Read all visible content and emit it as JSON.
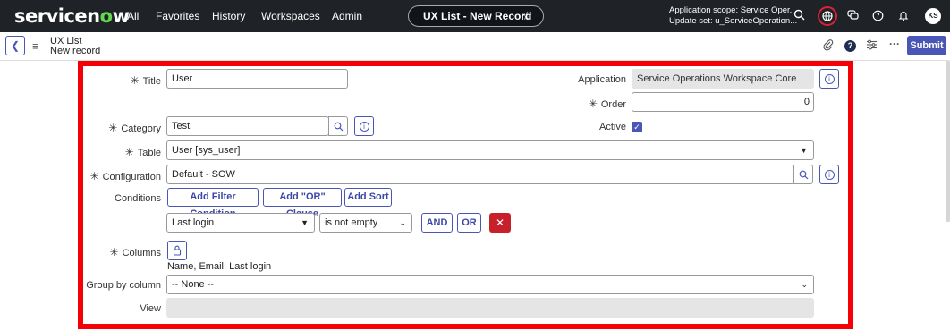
{
  "topnav": {
    "brand_prefix": "servicen",
    "brand_o": "o",
    "brand_suffix": "w",
    "items": [
      "All",
      "Favorites",
      "History",
      "Workspaces",
      "Admin"
    ],
    "pill_title": "UX List - New Record",
    "star_glyph": "☆",
    "scope_line1": "Application scope: Service Oper...",
    "scope_line2": "Update set: u_ServiceOperation...",
    "avatar_initials": "KS",
    "icons": [
      "search-icon",
      "globe-icon",
      "chat-icon",
      "help-icon",
      "bell-icon"
    ]
  },
  "subheader": {
    "record_type": "UX List",
    "record_state": "New record",
    "submit_label": "Submit",
    "icons": [
      "back-icon",
      "menu-icon",
      "attachment-icon",
      "help-icon",
      "settings-icon",
      "more-icon"
    ]
  },
  "form": {
    "title_label": "Title",
    "title_value": "User",
    "application_label": "Application",
    "application_value": "Service Operations Workspace Core",
    "order_label": "Order",
    "order_value": "0",
    "category_label": "Category",
    "category_value": "Test",
    "active_label": "Active",
    "active_checked": true,
    "table_label": "Table",
    "table_value": "User [sys_user]",
    "configuration_label": "Configuration",
    "configuration_value": "Default - SOW",
    "conditions_label": "Conditions",
    "add_filter_label": "Add Filter Condition",
    "add_or_label": "Add \"OR\" Clause",
    "add_sort_label": "Add Sort",
    "cond_field": "Last login",
    "cond_operator": "is not empty",
    "and_label": "AND",
    "or_label": "OR",
    "columns_label": "Columns",
    "columns_value": "Name, Email, Last login",
    "group_by_label": "Group by column",
    "group_by_value": "-- None --",
    "view_label": "View",
    "view_value": ""
  },
  "colors": {
    "accent": "#4a56b5",
    "topnav_bg": "#1f2328",
    "highlight_frame": "#f50006",
    "delete_button": "#c8202b",
    "brand_green": "#62d84e"
  }
}
